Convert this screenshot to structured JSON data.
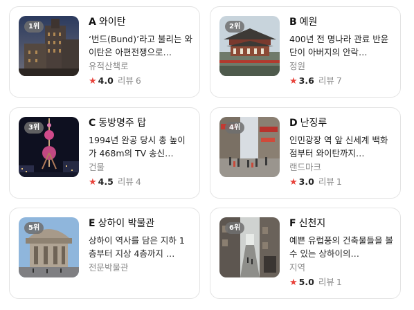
{
  "places": [
    {
      "rank": "1위",
      "letter": "A",
      "name": "와이탄",
      "desc": "‘번드(Bund)’라고 불리는 와이탄은 아편전쟁으로…",
      "category": "유적산책로",
      "score": "4.0",
      "review_label": "리뷰",
      "review_count": "6",
      "image_icon": "bund-building-photo"
    },
    {
      "rank": "2위",
      "letter": "B",
      "name": "예원",
      "desc": "400년 전 명나라 관료 반윤단이 아버지의 안락…",
      "category": "정원",
      "score": "3.6",
      "review_label": "리뷰",
      "review_count": "7",
      "image_icon": "yuyuan-pavilion-photo"
    },
    {
      "rank": "3위",
      "letter": "C",
      "name": "동방명주 탑",
      "desc": "1994년 완공 당시 총 높이가 468m의 TV 송신…",
      "category": "건물",
      "score": "4.5",
      "review_label": "리뷰",
      "review_count": "4",
      "image_icon": "tv-tower-night-photo"
    },
    {
      "rank": "4위",
      "letter": "D",
      "name": "난징루",
      "desc": "인민광장 역 앞 신세계 백화점부터 와이탄까지…",
      "category": "랜드마크",
      "score": "3.0",
      "review_label": "리뷰",
      "review_count": "1",
      "image_icon": "shopping-street-photo"
    },
    {
      "rank": "5위",
      "letter": "E",
      "name": "상하이 박물관",
      "desc": "상하이 역사를 담은 지하 1층부터 지상 4층까지 …",
      "category": "전문박물관",
      "score": "",
      "review_label": "",
      "review_count": "",
      "image_icon": "museum-photo"
    },
    {
      "rank": "6위",
      "letter": "F",
      "name": "신천지",
      "desc": "예쁜 유럽풍의 건축물들을 볼 수 있는 상하이의…",
      "category": "지역",
      "score": "5.0",
      "review_label": "리뷰",
      "review_count": "1",
      "image_icon": "alley-photo"
    }
  ],
  "colors": {
    "star": "#e8423a",
    "rank_badge": "#6e6e6e",
    "border": "#e3e3e3"
  }
}
